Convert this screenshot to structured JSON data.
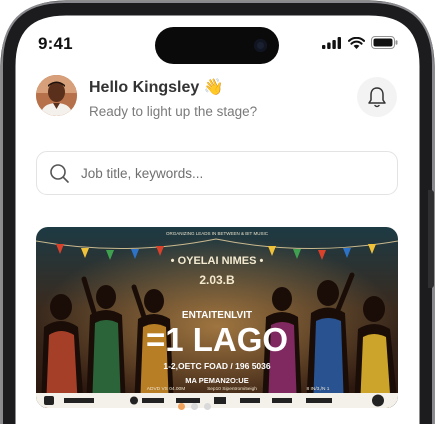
{
  "status_bar": {
    "time": "9:41"
  },
  "header": {
    "greeting": "Hello Kingsley 👋",
    "subtitle": "Ready to light up the stage?",
    "avatar_icon": "user-avatar",
    "bell_icon": "bell-icon"
  },
  "search": {
    "placeholder": "Job title, keywords..."
  },
  "banner": {
    "top_line": "ORGANIZING LEADS IN BETWEEN & BIT MUSIC",
    "headline_1": "• OYELAI NIMES •",
    "headline_2": "2.03.B",
    "entertainment": "ENTAITENLVIT",
    "title": "=1 LAGO",
    "info_1": "1-2,OETC FOAD / 196 5036",
    "info_2": "MA PEMAN2O:UE",
    "time_left": "ADVD VS 04.00M",
    "time_mid": "Sep10 Sipentromi5eigh",
    "time_right": "8 IN/3,/N 1"
  },
  "carousel": {
    "count": 3,
    "active": 0
  },
  "colors": {
    "accent": "#f0a15a",
    "frame": "#1c1c1e"
  }
}
